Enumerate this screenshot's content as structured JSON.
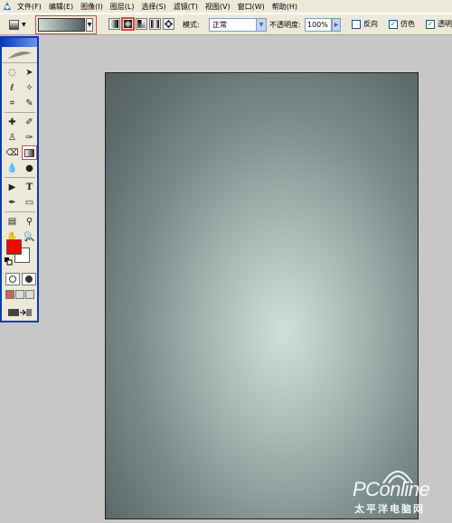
{
  "menu": {
    "items": [
      "文件(F)",
      "编辑(E)",
      "图像(I)",
      "图层(L)",
      "选择(S)",
      "滤镜(T)",
      "视图(V)",
      "窗口(W)",
      "帮助(H)"
    ]
  },
  "options": {
    "mode_label": "模式:",
    "mode_value": "正常",
    "opacity_label": "不透明度:",
    "opacity_value": "100%",
    "reverse_label": "反向",
    "reverse_checked": false,
    "dither_label": "仿色",
    "dither_checked": true,
    "transparency_label": "透明区域",
    "transparency_checked": true,
    "gradient_colors": [
      "#cfdcd6",
      "#4f5e5d"
    ],
    "selected_gradient_type": "radial"
  },
  "toolbox": {
    "foreground_color": "#ff0000",
    "background_color": "#ffffff",
    "active_tool": "gradient-tool"
  },
  "canvas": {
    "gradient_center_color": "#d0dfd8",
    "gradient_edge_color": "#56625f"
  },
  "watermark": {
    "brand": "PConline",
    "subtitle": "太平洋电脑网"
  }
}
